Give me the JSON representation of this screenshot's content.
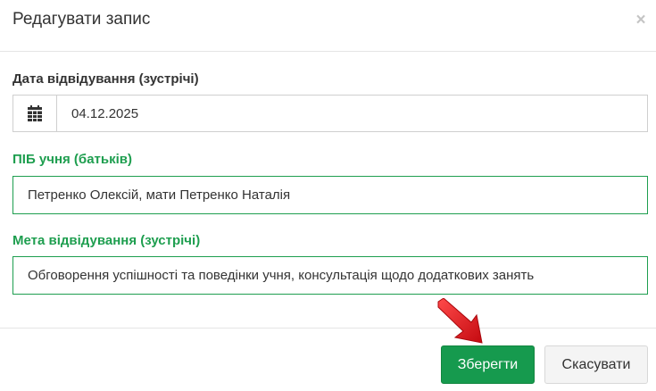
{
  "modal": {
    "title": "Редагувати запис",
    "close_icon": "×"
  },
  "form": {
    "date_label": "Дата відвідування (зустрічі)",
    "date_value": "04.12.2025",
    "date_icon": "calendar-icon",
    "student_label": "ПІБ учня (батьків)",
    "student_value": "Петренко Олексій, мати Петренко Наталія",
    "purpose_label": "Мета відвідування (зустрічі)",
    "purpose_value": "Обговорення успішності та поведінки учня, консультація щодо додаткових занять"
  },
  "footer": {
    "save_label": "Зберегти",
    "cancel_label": "Скасувати"
  },
  "colors": {
    "accent": "#1e9e4f",
    "save_button": "#169a4e",
    "arrow": "#e8141c"
  }
}
